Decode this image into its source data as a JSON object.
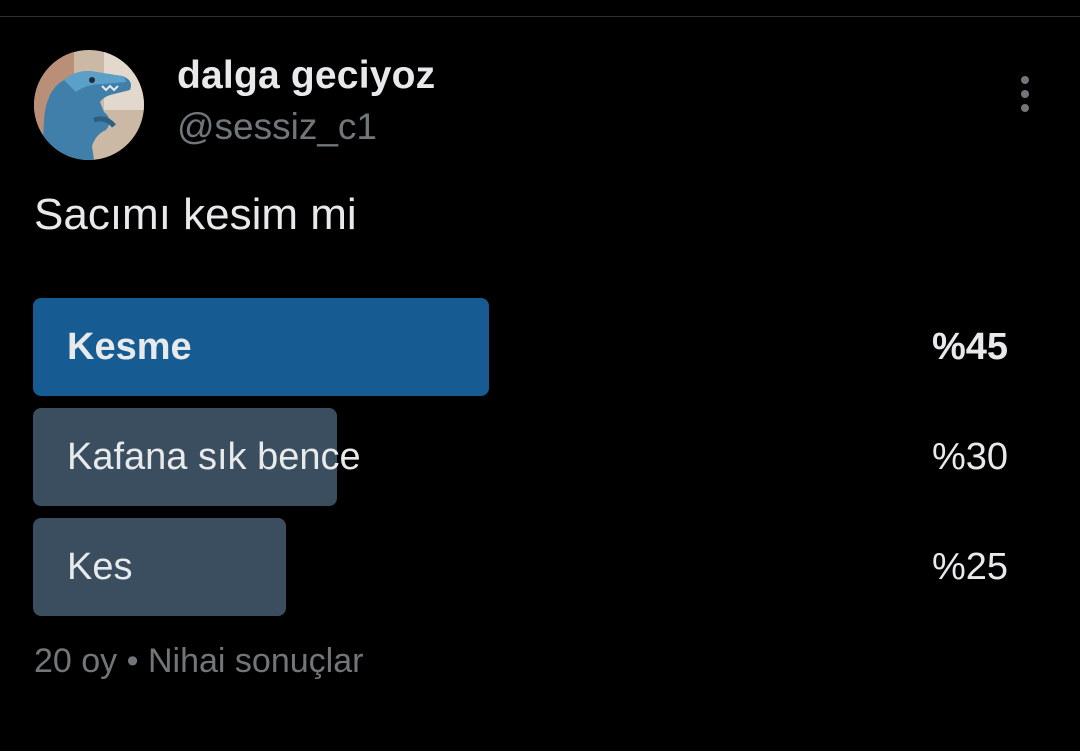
{
  "author": {
    "display_name": "dalga geciyoz",
    "handle": "@sessiz_c1",
    "avatar_icon": "dinosaur-avatar"
  },
  "tweet": {
    "text": "Sacımı kesim mi"
  },
  "poll": {
    "options": [
      {
        "label": "Kesme",
        "percent_text": "%45",
        "percent": 45,
        "winner": true
      },
      {
        "label": "Kafana sık bence",
        "percent_text": "%30",
        "percent": 30,
        "winner": false
      },
      {
        "label": "Kes",
        "percent_text": "%25",
        "percent": 25,
        "winner": false
      }
    ],
    "votes": "20 oy",
    "separator": "•",
    "status": "Nihai sonuçlar"
  },
  "colors": {
    "background": "#000000",
    "text": "#e7e9ea",
    "muted": "#71767b",
    "winner_bar": "#165b91",
    "bar": "#3a4e60"
  },
  "icons": {
    "more": "more-vertical-icon"
  }
}
